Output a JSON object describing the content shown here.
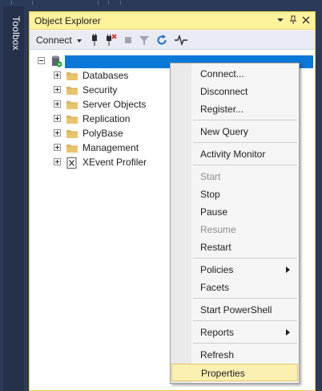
{
  "toolbox": {
    "label": "Toolbox"
  },
  "panel": {
    "title": "Object Explorer",
    "buttons": {
      "dropdown_icon": "dropdown-arrow-icon",
      "pin_icon": "pin-icon",
      "close_icon": "close-icon"
    }
  },
  "toolbar": {
    "connect_label": "Connect",
    "icons": [
      "connect-icon",
      "disconnect-icon",
      "stop-icon",
      "filter-icon",
      "refresh-icon",
      "activity-monitor-icon"
    ]
  },
  "tree": {
    "root": {
      "label": "",
      "icon": "server-icon",
      "selected": true
    },
    "nodes": [
      {
        "label": "Databases",
        "icon": "folder-icon"
      },
      {
        "label": "Security",
        "icon": "folder-icon"
      },
      {
        "label": "Server Objects",
        "icon": "folder-icon"
      },
      {
        "label": "Replication",
        "icon": "folder-icon"
      },
      {
        "label": "PolyBase",
        "icon": "folder-icon"
      },
      {
        "label": "Management",
        "icon": "folder-icon"
      },
      {
        "label": "XEvent Profiler",
        "icon": "xevent-profiler-icon"
      }
    ]
  },
  "context_menu": {
    "items": [
      {
        "label": "Connect...",
        "enabled": true
      },
      {
        "label": "Disconnect",
        "enabled": true
      },
      {
        "label": "Register...",
        "enabled": true
      },
      {
        "label": "New Query",
        "enabled": true
      },
      {
        "label": "Activity Monitor",
        "enabled": true
      },
      {
        "label": "Start",
        "enabled": false
      },
      {
        "label": "Stop",
        "enabled": true
      },
      {
        "label": "Pause",
        "enabled": true
      },
      {
        "label": "Resume",
        "enabled": false
      },
      {
        "label": "Restart",
        "enabled": true
      },
      {
        "label": "Policies",
        "enabled": true,
        "submenu": true
      },
      {
        "label": "Facets",
        "enabled": true
      },
      {
        "label": "Start PowerShell",
        "enabled": true
      },
      {
        "label": "Reports",
        "enabled": true,
        "submenu": true
      },
      {
        "label": "Refresh",
        "enabled": true
      },
      {
        "label": "Properties",
        "enabled": true,
        "highlighted": true
      }
    ]
  },
  "colors": {
    "title_bar": "#fff29d",
    "selection": "#0a78d7",
    "menu_highlight": "#fbf0b2",
    "ide_background": "#2b3a58"
  }
}
